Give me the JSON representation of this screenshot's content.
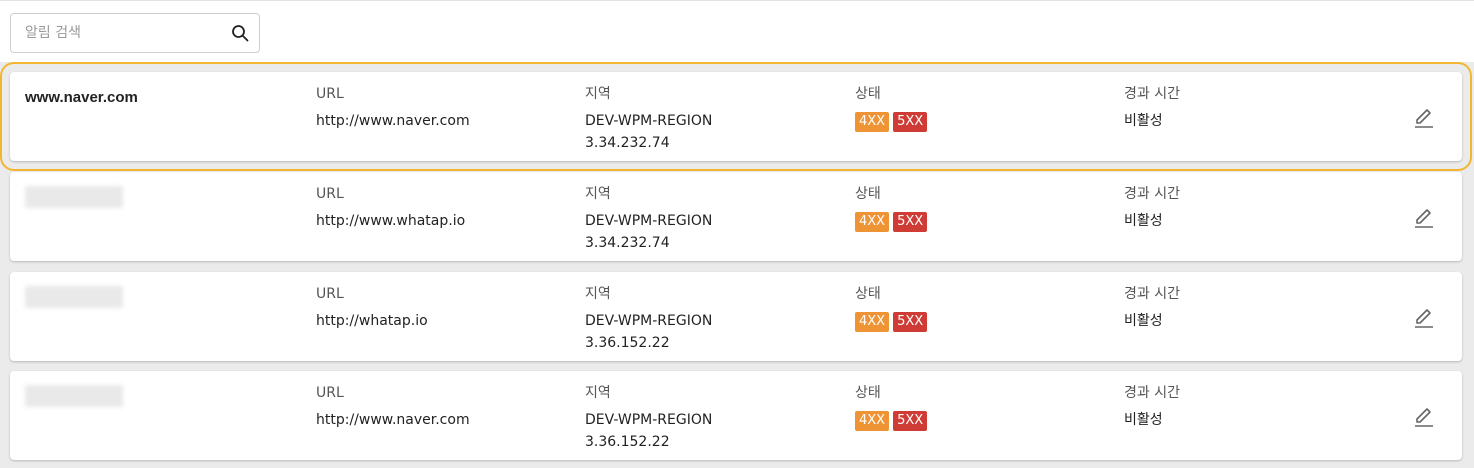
{
  "search": {
    "placeholder": "알림 검색",
    "value": ""
  },
  "labels": {
    "url": "URL",
    "region": "지역",
    "status": "상태",
    "elapsed": "경과 시간"
  },
  "colors": {
    "badge_4xx": "#ef9434",
    "badge_5xx": "#cf3b35",
    "selected_outline": "#f2b632"
  },
  "items": [
    {
      "name": "www.naver.com",
      "url": "http://www.naver.com",
      "region": "DEV-WPM-REGION",
      "ip": "3.34.232.74",
      "badges": [
        "4XX",
        "5XX"
      ],
      "elapsed": "비활성",
      "selected": true
    },
    {
      "name": "",
      "url": "http://www.whatap.io",
      "region": "DEV-WPM-REGION",
      "ip": "3.34.232.74",
      "badges": [
        "4XX",
        "5XX"
      ],
      "elapsed": "비활성",
      "selected": false
    },
    {
      "name": "",
      "url": "http://whatap.io",
      "region": "DEV-WPM-REGION",
      "ip": "3.36.152.22",
      "badges": [
        "4XX",
        "5XX"
      ],
      "elapsed": "비활성",
      "selected": false
    },
    {
      "name": "",
      "url": "http://www.naver.com",
      "region": "DEV-WPM-REGION",
      "ip": "3.36.152.22",
      "badges": [
        "4XX",
        "5XX"
      ],
      "elapsed": "비활성",
      "selected": false
    }
  ]
}
